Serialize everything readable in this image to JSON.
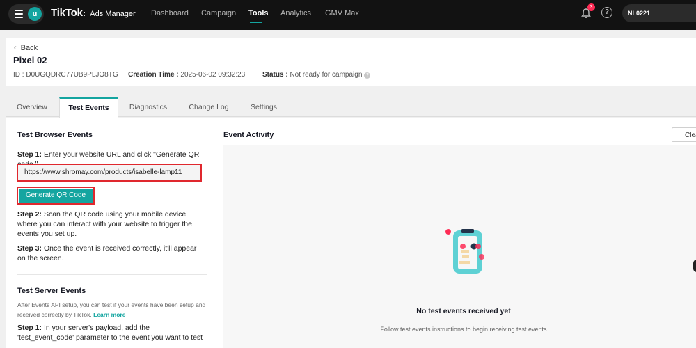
{
  "topbar": {
    "avatar_letter": "u",
    "brand": "TikTok",
    "brand_sep": ":",
    "brand_sub": "Ads Manager",
    "nav": [
      "Dashboard",
      "Campaign",
      "Tools",
      "Analytics",
      "GMV Max"
    ],
    "active_nav": "Tools",
    "notification_count": "3",
    "help_glyph": "?",
    "account": "NL0221"
  },
  "header": {
    "back_label": "Back",
    "pixel_name": "Pixel 02",
    "id_label": "ID :",
    "id_value": "D0UGQDRC77UB9PLJO8TG",
    "creation_label": "Creation Time :",
    "creation_value": "2025-06-02 09:32:23",
    "status_label": "Status :",
    "status_value": "Not ready for campaign"
  },
  "tabs": [
    "Overview",
    "Test Events",
    "Diagnostics",
    "Change Log",
    "Settings"
  ],
  "active_tab": "Test Events",
  "browser_events": {
    "title": "Test Browser Events",
    "step1_label": "Step 1:",
    "step1_text": "Enter your website URL and click \"Generate QR code.\"",
    "url_value": "https://www.shromay.com/products/isabelle-lamp11",
    "generate_button": "Generate QR Code",
    "step2_label": "Step 2:",
    "step2_text": "Scan the QR code using your mobile device where you can interact with your website to trigger the events you set up.",
    "step3_label": "Step 3:",
    "step3_text": "Once the event is received correctly, it'll appear on the screen."
  },
  "server_events": {
    "title": "Test Server Events",
    "description": "After Events API setup, you can test if your events have been setup and received correctly by TikTok.",
    "learn_more": "Learn more",
    "step1_label": "Step 1:",
    "step1_text": "In your server's payload, add the 'test_event_code' parameter to the event you want to test"
  },
  "activity": {
    "title": "Event Activity",
    "clear_button": "Clea",
    "empty_title": "No test events received yet",
    "empty_subtitle": "Follow test events instructions to begin receiving test events"
  },
  "colors": {
    "accent": "#14a5a0",
    "topbar_bg": "#121212",
    "highlight_border": "#e0282e",
    "badge": "#fe2c55"
  }
}
